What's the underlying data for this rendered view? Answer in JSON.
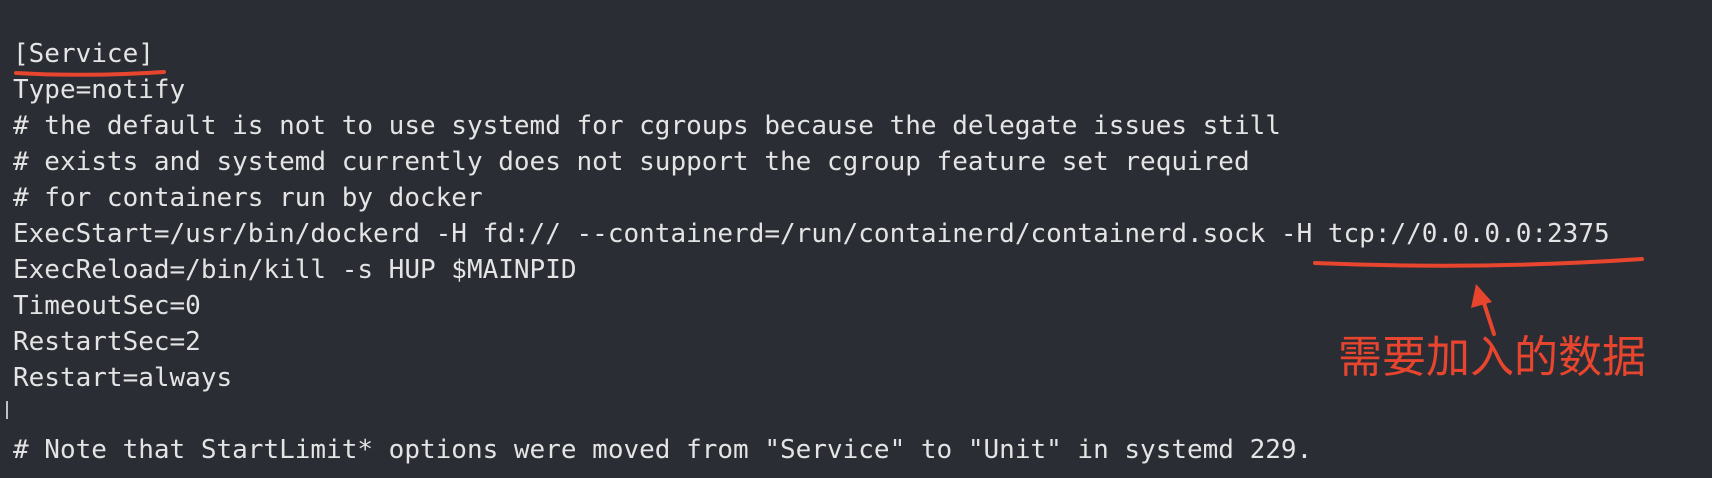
{
  "terminal": {
    "lines": [
      "[Service]",
      "Type=notify",
      "# the default is not to use systemd for cgroups because the delegate issues still",
      "# exists and systemd currently does not support the cgroup feature set required",
      "# for containers run by docker",
      "ExecStart=/usr/bin/dockerd -H fd:// --containerd=/run/containerd/containerd.sock -H tcp://0.0.0.0:2375",
      "ExecReload=/bin/kill -s HUP $MAINPID",
      "TimeoutSec=0",
      "RestartSec=2",
      "Restart=always",
      "",
      "# Note that StartLimit* options were moved from \"Service\" to \"Unit\" in systemd 229."
    ]
  },
  "annotation": {
    "label": "需要加入的数据",
    "color": "#e8452e"
  }
}
